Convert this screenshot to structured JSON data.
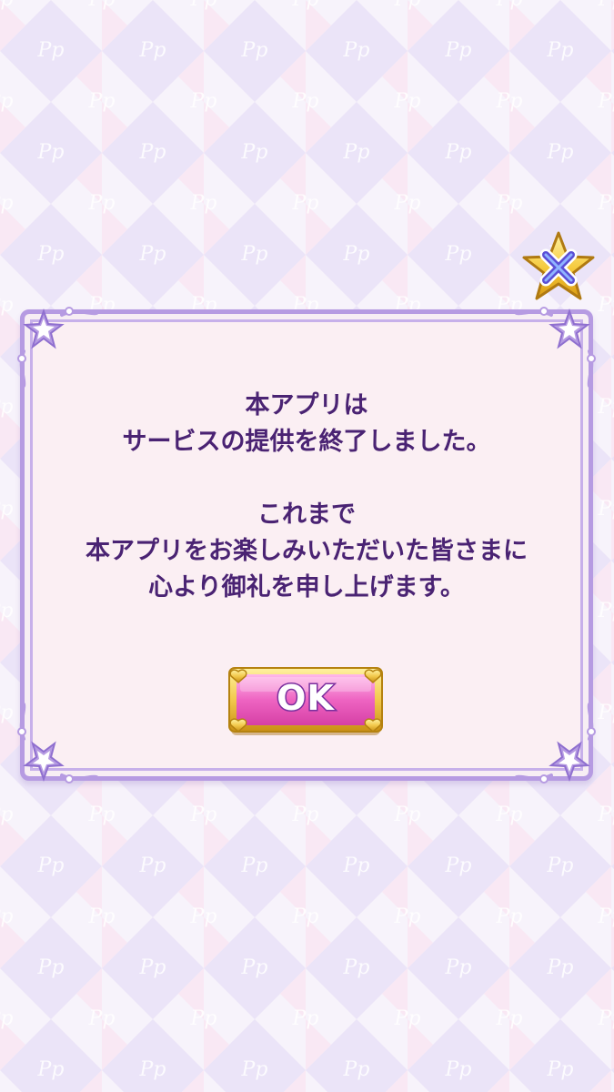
{
  "dialog": {
    "lines_group1": [
      "本アプリは",
      "サービスの提供を終了しました。"
    ],
    "lines_group2": [
      "これまで",
      "本アプリをお楽しみいただいた皆さまに",
      "心より御礼を申し上げます。"
    ],
    "ok_label": "OK"
  },
  "background": {
    "watermark_text": "Pp"
  },
  "icons": {
    "close": "close-x-icon",
    "corner": "star-corner-ornament-icon",
    "button_corner": "heart-corner-icon"
  },
  "colors": {
    "text": "#4a2373",
    "dialog_border": "#b69be2",
    "dialog_bg": "#fbeff3",
    "button_pink": "#e85ab8",
    "button_gold": "#f2c94c"
  }
}
